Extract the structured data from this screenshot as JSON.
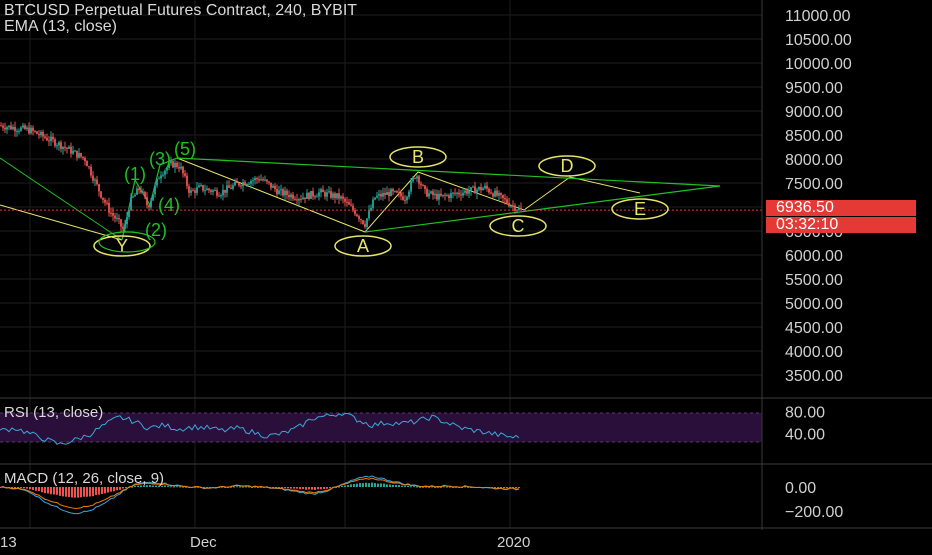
{
  "header": {
    "title": "BTCUSD Perpetual Futures Contract, 240, BYBIT",
    "indicator": "EMA (13, close)"
  },
  "colors": {
    "background": "#000000",
    "grid": "#1e1e1e",
    "up": "#26a69a",
    "down": "#ef5350",
    "wave_green": "#21c021",
    "wave_yellow": "#e6e46a",
    "rsi_band": "#2a0f3a",
    "badge": "#e53935"
  },
  "price_badge": {
    "last_price": "6936.50",
    "countdown": "03:32:10"
  },
  "rsi": {
    "label": "RSI (13, close)",
    "ticks": [
      "80.00",
      "40.00"
    ]
  },
  "macd": {
    "label": "MACD (12, 26, close, 9)",
    "ticks": [
      "0.00",
      "−200.00"
    ]
  },
  "chart_data": {
    "type": "candlestick",
    "y_ticks": [
      "11000.00",
      "10500.00",
      "10000.00",
      "9500.00",
      "9000.00",
      "8500.00",
      "8000.00",
      "7500.00",
      "7000.00",
      "6500.00",
      "6000.00",
      "5500.00",
      "5000.00",
      "4500.00",
      "4000.00",
      "3500.00"
    ],
    "ylim": [
      3300,
      11200
    ],
    "x_ticks": [
      "13",
      "Dec",
      "2020"
    ],
    "series": [
      {
        "x": [
          0,
          30,
          60,
          85,
          100,
          110,
          118,
          124,
          130,
          140,
          148,
          160,
          172,
          180,
          190,
          200,
          220,
          240,
          260,
          280,
          300,
          320,
          340,
          355,
          365,
          375,
          390,
          405,
          416,
          425,
          440,
          460,
          485,
          500,
          515,
          521
        ],
        "values": [
          8700,
          8600,
          8300,
          8000,
          7300,
          6900,
          6700,
          6500,
          7100,
          7400,
          7000,
          7700,
          7900,
          7850,
          7300,
          7400,
          7300,
          7500,
          7600,
          7300,
          7200,
          7300,
          7200,
          6900,
          6650,
          7200,
          7300,
          7200,
          7700,
          7300,
          7200,
          7300,
          7400,
          7200,
          7000,
          6936
        ]
      }
    ],
    "wave_labels": [
      {
        "text": "(5)",
        "color": "#21c021"
      },
      {
        "text": "(3)",
        "color": "#21c021"
      },
      {
        "text": "(1)",
        "color": "#21c021"
      },
      {
        "text": "(4)",
        "color": "#21c021"
      },
      {
        "text": "(2)",
        "color": "#21c021"
      },
      {
        "text": "Y",
        "color": "#e6e46a"
      },
      {
        "text": "A",
        "color": "#e6e46a"
      },
      {
        "text": "B",
        "color": "#e6e46a"
      },
      {
        "text": "C",
        "color": "#e6e46a"
      },
      {
        "text": "D",
        "color": "#e6e46a"
      },
      {
        "text": "E",
        "color": "#e6e46a"
      }
    ],
    "rsi_series": [
      45,
      50,
      40,
      30,
      20,
      28,
      38,
      55,
      70,
      62,
      50,
      55,
      48,
      52,
      50,
      45,
      50,
      42,
      35,
      40,
      50,
      68,
      72,
      78,
      65,
      55,
      60,
      58,
      62,
      70,
      60,
      50,
      45,
      40,
      35,
      32
    ],
    "macd_series": [
      0,
      -10,
      -40,
      -120,
      -180,
      -220,
      -200,
      -140,
      -60,
      20,
      40,
      30,
      10,
      0,
      -10,
      0,
      10,
      5,
      -5,
      -20,
      -40,
      -60,
      -30,
      20,
      70,
      90,
      60,
      30,
      10,
      5,
      10,
      5,
      0,
      -10,
      -15,
      -20
    ]
  }
}
